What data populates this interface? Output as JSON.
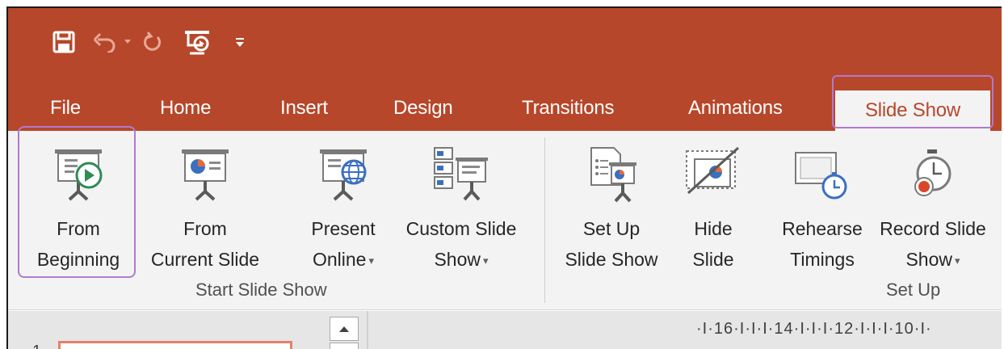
{
  "quick_access": [
    {
      "icon": "save-icon"
    },
    {
      "icon": "undo-icon"
    },
    {
      "icon": "redo-icon"
    },
    {
      "icon": "start-from-beginning-icon"
    },
    {
      "icon": "customize-qat-icon"
    }
  ],
  "tabs": {
    "file": "File",
    "home": "Home",
    "insert": "Insert",
    "design": "Design",
    "transitions": "Transitions",
    "animations": "Animations",
    "slide_show": "Slide Show"
  },
  "active_tab": "Slide Show",
  "groups": {
    "start": {
      "label": "Start Slide Show",
      "buttons": {
        "from_beginning": {
          "line1": "From",
          "line2": "Beginning",
          "icon": "from-beginning-icon"
        },
        "from_current": {
          "line1": "From",
          "line2": "Current Slide",
          "icon": "from-current-slide-icon"
        },
        "present_online": {
          "line1": "Present",
          "line2": "Online",
          "icon": "present-online-icon",
          "dropdown": true
        },
        "custom_show": {
          "line1": "Custom Slide",
          "line2": "Show",
          "icon": "custom-slide-show-icon",
          "dropdown": true
        }
      }
    },
    "setup": {
      "label": "Set Up",
      "buttons": {
        "setup_show": {
          "line1": "Set Up",
          "line2": "Slide Show",
          "icon": "set-up-slide-show-icon"
        },
        "hide_slide": {
          "line1": "Hide",
          "line2": "Slide",
          "icon": "hide-slide-icon"
        },
        "rehearse": {
          "line1": "Rehearse",
          "line2": "Timings",
          "icon": "rehearse-timings-icon"
        },
        "record": {
          "line1": "Record Slide",
          "line2": "Show",
          "icon": "record-slide-show-icon",
          "dropdown": true
        }
      }
    }
  },
  "caret": "▾",
  "slide_thumbnail_number": "1",
  "ruler_text": "·I·16·I·I·I·14·I·I·I·12·I·I·I·10·I·",
  "colors": {
    "title_bar": "#b7472a",
    "ribbon": "#f3f3f3",
    "highlight": "#b07ad0"
  }
}
